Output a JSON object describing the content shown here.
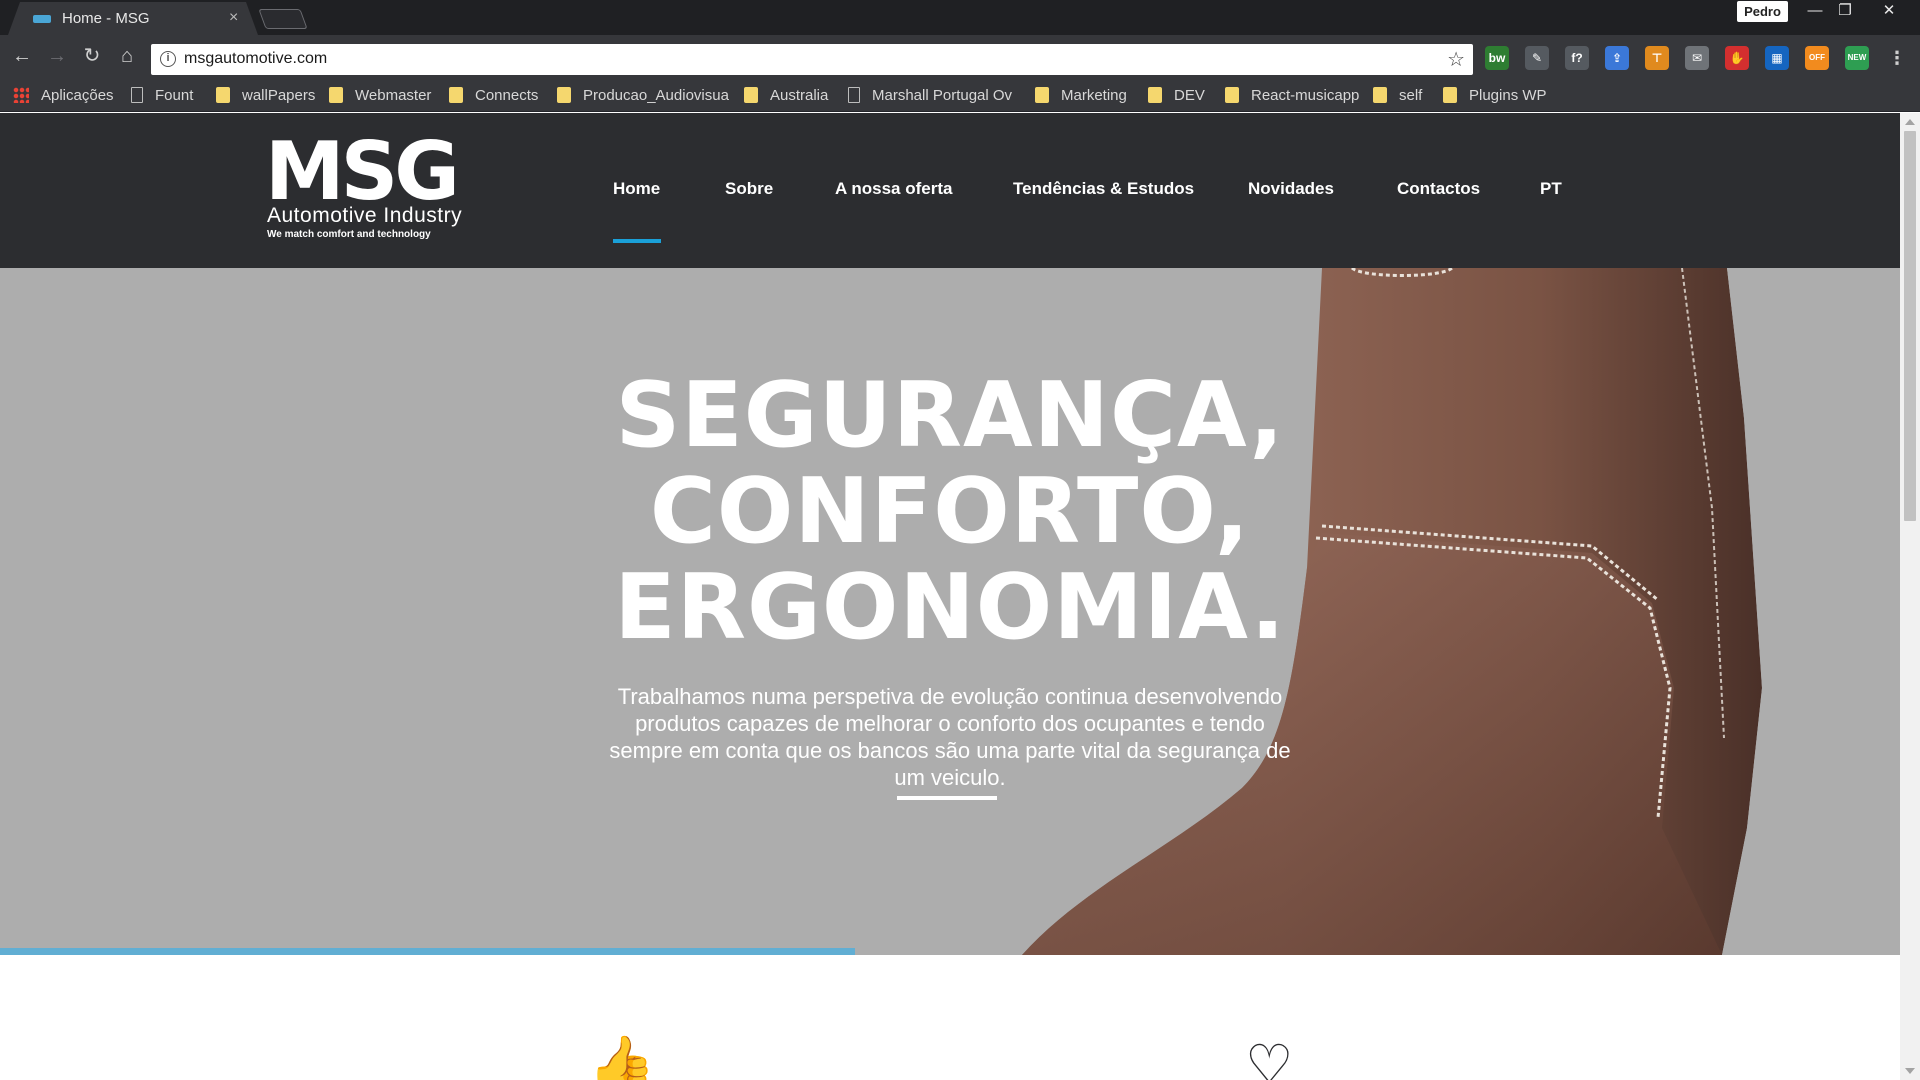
{
  "browser": {
    "tab_title": "Home - MSG",
    "tab_close": "×",
    "profile_name": "Pedro",
    "url": "msgautomotive.com",
    "info_glyph": "i",
    "bookmarks": [
      {
        "label": "Aplicações",
        "kind": "apps"
      },
      {
        "label": "Fount",
        "kind": "page"
      },
      {
        "label": "wallPapers",
        "kind": "folder"
      },
      {
        "label": "Webmaster",
        "kind": "folder"
      },
      {
        "label": "Connects",
        "kind": "folder"
      },
      {
        "label": "Producao_Audiovisua",
        "kind": "folder"
      },
      {
        "label": "Australia",
        "kind": "folder"
      },
      {
        "label": "Marshall Portugal Ov",
        "kind": "page"
      },
      {
        "label": "Marketing",
        "kind": "folder"
      },
      {
        "label": "DEV",
        "kind": "folder"
      },
      {
        "label": "React-musicapp",
        "kind": "folder"
      },
      {
        "label": "self",
        "kind": "folder"
      },
      {
        "label": "Plugins WP",
        "kind": "folder"
      }
    ],
    "extensions": [
      {
        "name": "bw-extension-icon",
        "label": "bw",
        "color": "#2e7d32"
      },
      {
        "name": "eyedropper-extension-icon",
        "label": "✎",
        "color": "#555a60"
      },
      {
        "name": "font-finder-extension-icon",
        "label": "f?",
        "color": "#555a60"
      },
      {
        "name": "upload-extension-icon",
        "label": "⇪",
        "color": "#3b78d8"
      },
      {
        "name": "ruler-extension-icon",
        "label": "⊤",
        "color": "#e08a1e"
      },
      {
        "name": "mail-extension-icon",
        "label": "✉",
        "color": "#6f7378"
      },
      {
        "name": "adblock-extension-icon",
        "label": "✋",
        "color": "#d32f2f"
      },
      {
        "name": "grid-extension-icon",
        "label": "▦",
        "color": "#1565c0"
      },
      {
        "name": "off-extension-icon",
        "label": "OFF",
        "color": "#f28b1e"
      },
      {
        "name": "new-extension-icon",
        "label": "NEW",
        "color": "#2e9e52"
      }
    ]
  },
  "site": {
    "logo_mark": "MSG",
    "logo_tagline": "Automotive Industry",
    "logo_subtagline": "We match comfort and technology",
    "nav": [
      "Home",
      "Sobre",
      "A nossa oferta",
      "Tendências & Estudos",
      "Novidades",
      "Contactos",
      "PT"
    ],
    "active_nav": "Home",
    "accent_color": "#1aa0d8"
  },
  "hero": {
    "title_lines": [
      "SEGURANÇA,",
      "CONFORTO,",
      "ERGONOMIA."
    ],
    "text": "Trabalhamos numa perspetiva de evolução continua desenvolvendo produtos capazes de melhorar o conforto dos ocupantes e tendo sempre em conta que os bancos são uma parte vital da segurança de um veiculo.",
    "slider_progress": 0.45
  },
  "features": [
    {
      "icon": "thumbs-up-icon",
      "glyph": "👍"
    },
    {
      "icon": "heart-icon",
      "glyph": "♡"
    }
  ]
}
